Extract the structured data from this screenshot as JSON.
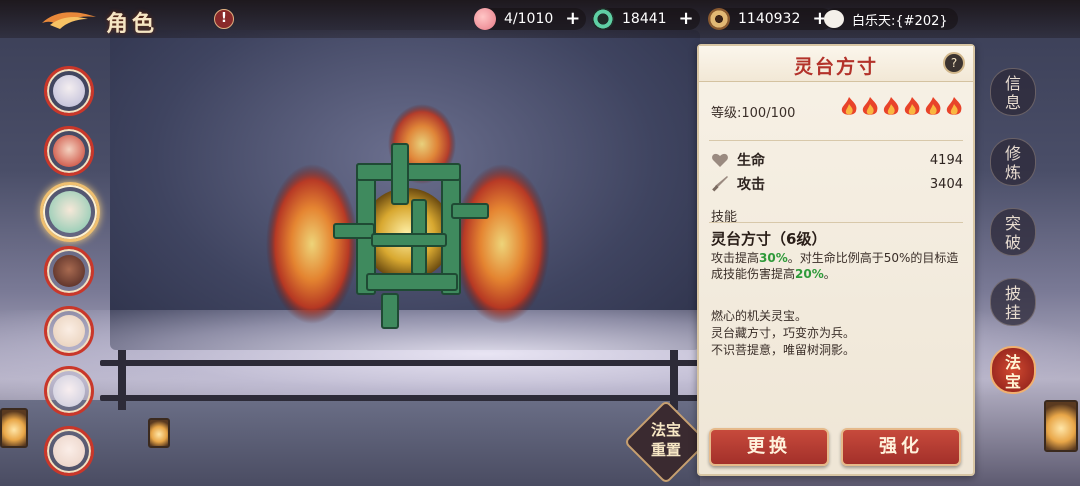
{
  "header": {
    "title": "角色",
    "alert_label": "!"
  },
  "resources": {
    "peach": {
      "value": "4/1010",
      "plus": "+"
    },
    "jade": {
      "value": "18441",
      "plus": "+"
    },
    "coin": {
      "value": "1140932",
      "plus": "+"
    },
    "chat": {
      "value": "白乐天:{#202}"
    }
  },
  "characters": [
    {
      "label": "character-1",
      "selected": false,
      "color": "#c7c8e6"
    },
    {
      "label": "character-2",
      "selected": false,
      "color": "#d04a38"
    },
    {
      "label": "character-3",
      "selected": true,
      "color": "#8fd2bc"
    },
    {
      "label": "character-4",
      "selected": false,
      "color": "#6a3a30"
    },
    {
      "label": "character-5",
      "selected": false,
      "color": "#f0dcc8"
    },
    {
      "label": "character-6",
      "selected": false,
      "color": "#dadce8"
    },
    {
      "label": "character-7",
      "selected": false,
      "color": "#f4e2d8"
    }
  ],
  "panel": {
    "title": "灵台方寸",
    "info_icon": "?",
    "level_label": "等级:100/100",
    "flame_count": 6,
    "stats": [
      {
        "label": "生命",
        "value": "4194",
        "icon": "heart-icon"
      },
      {
        "label": "攻击",
        "value": "3404",
        "icon": "sword-icon"
      }
    ],
    "skill_section_label": "技能",
    "skill_name": "灵台方寸（6级）",
    "skill_desc": {
      "p1": "攻击提高",
      "h1": "30%",
      "p2": "。对生命比例高于50%的目标造成技能伤害提高",
      "h2": "20%",
      "p3": "。"
    },
    "lore": [
      "燃心的机关灵宝。",
      "灵台藏方寸，巧变亦为兵。",
      "不识菩提意，唯留树洞影。"
    ],
    "buttons": {
      "replace": "更换",
      "enhance": "强化"
    }
  },
  "reset_button": {
    "line1": "法宝",
    "line2": "重置"
  },
  "tabs": [
    {
      "label_1": "信",
      "label_2": "息",
      "active": false
    },
    {
      "label_1": "修",
      "label_2": "炼",
      "active": false
    },
    {
      "label_1": "突",
      "label_2": "破",
      "active": false
    },
    {
      "label_1": "披",
      "label_2": "挂",
      "active": false
    },
    {
      "label_1": "法",
      "label_2": "宝",
      "active": true
    }
  ],
  "colors": {
    "accent_red": "#b3322a",
    "highlight_green": "#2f9a3a",
    "panel_bg": "#f7f1e6"
  }
}
